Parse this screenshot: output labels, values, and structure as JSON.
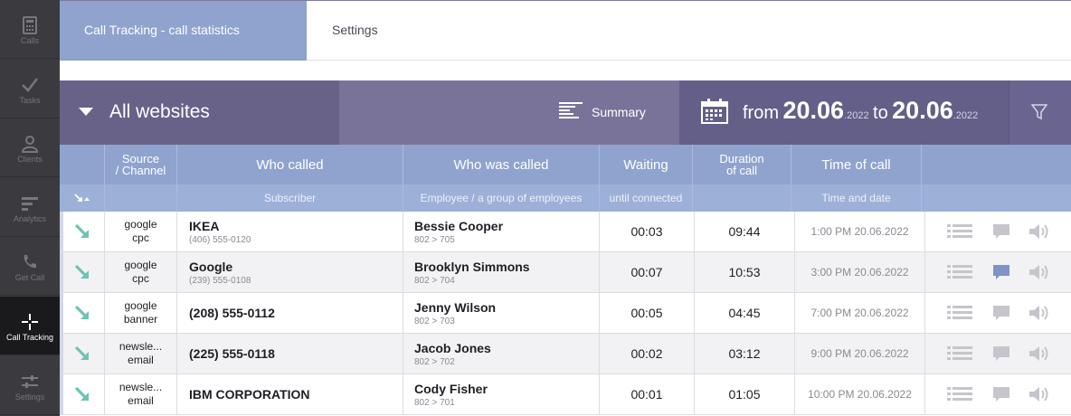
{
  "sidebar": {
    "items": [
      {
        "label": "Calls",
        "icon": "calculator-icon"
      },
      {
        "label": "Tasks",
        "icon": "checkmark-icon"
      },
      {
        "label": "Clients",
        "icon": "user-icon"
      },
      {
        "label": "Analytics",
        "icon": "analytics-icon"
      },
      {
        "label": "Get Call",
        "icon": "phone-icon"
      },
      {
        "label": "Call Tracking",
        "icon": "crosshair-icon",
        "active": true
      },
      {
        "label": "Settings",
        "icon": "sliders-icon"
      }
    ]
  },
  "tabs": {
    "active": "Call Tracking - call statistics",
    "settings": "Settings"
  },
  "filter": {
    "sites": "All websites",
    "summary": "Summary",
    "from_word": "from",
    "from_date": "20.06",
    "from_year": ".2022",
    "to_word": "to",
    "to_date": "20.06",
    "to_year": ".2022"
  },
  "table": {
    "headers": {
      "source_line1": "Source",
      "source_line2": "/ Channel",
      "who_called": "Who called",
      "who_was_called": "Who was called",
      "waiting": "Waiting",
      "duration_line1": "Duration",
      "duration_line2": "of call",
      "time_of_call": "Time of call"
    },
    "subheaders": {
      "who_called": "Subscriber",
      "who_was_called": "Employee / a group of employees",
      "waiting": "until connected",
      "time_of_call": "Time and date"
    },
    "rows": [
      {
        "source": "google",
        "channel": "cpc",
        "caller": "IKEA",
        "caller_phone": "(406) 555-0120",
        "employee": "Bessie Cooper",
        "route": "802 > 705",
        "waiting": "00:03",
        "duration": "09:44",
        "time": "1:00 PM 20.06.2022",
        "comment": false
      },
      {
        "source": "google",
        "channel": "cpc",
        "caller": "Google",
        "caller_phone": "(239) 555-0108",
        "employee": "Brooklyn Simmons",
        "route": "802 > 704",
        "waiting": "00:07",
        "duration": "10:53",
        "time": "3:00 PM 20.06.2022",
        "comment": true
      },
      {
        "source": "google",
        "channel": "banner",
        "caller": "(208) 555-0112",
        "caller_phone": "",
        "employee": "Jenny Wilson",
        "route": "802 > 703",
        "waiting": "00:05",
        "duration": "04:45",
        "time": "7:00 PM 20.06.2022",
        "comment": false
      },
      {
        "source": "newsle...",
        "channel": "email",
        "caller": "(225) 555-0118",
        "caller_phone": "",
        "employee": "Jacob Jones",
        "route": "802 > 702",
        "waiting": "00:02",
        "duration": "03:12",
        "time": "9:00 PM 20.06.2022",
        "comment": false
      },
      {
        "source": "newsle...",
        "channel": "email",
        "caller": "IBM CORPORATION",
        "caller_phone": "",
        "employee": "Cody Fisher",
        "route": "802 > 701",
        "waiting": "00:01",
        "duration": "01:05",
        "time": "10:00 PM 20.06.2022",
        "comment": false
      }
    ]
  },
  "colors": {
    "accent": "#8fa3ce",
    "sidebar": "#3b3b3f",
    "filterbar": "#6a6590",
    "incoming_arrow": "#6ec3b4",
    "comment_active": "#7f93c8"
  }
}
